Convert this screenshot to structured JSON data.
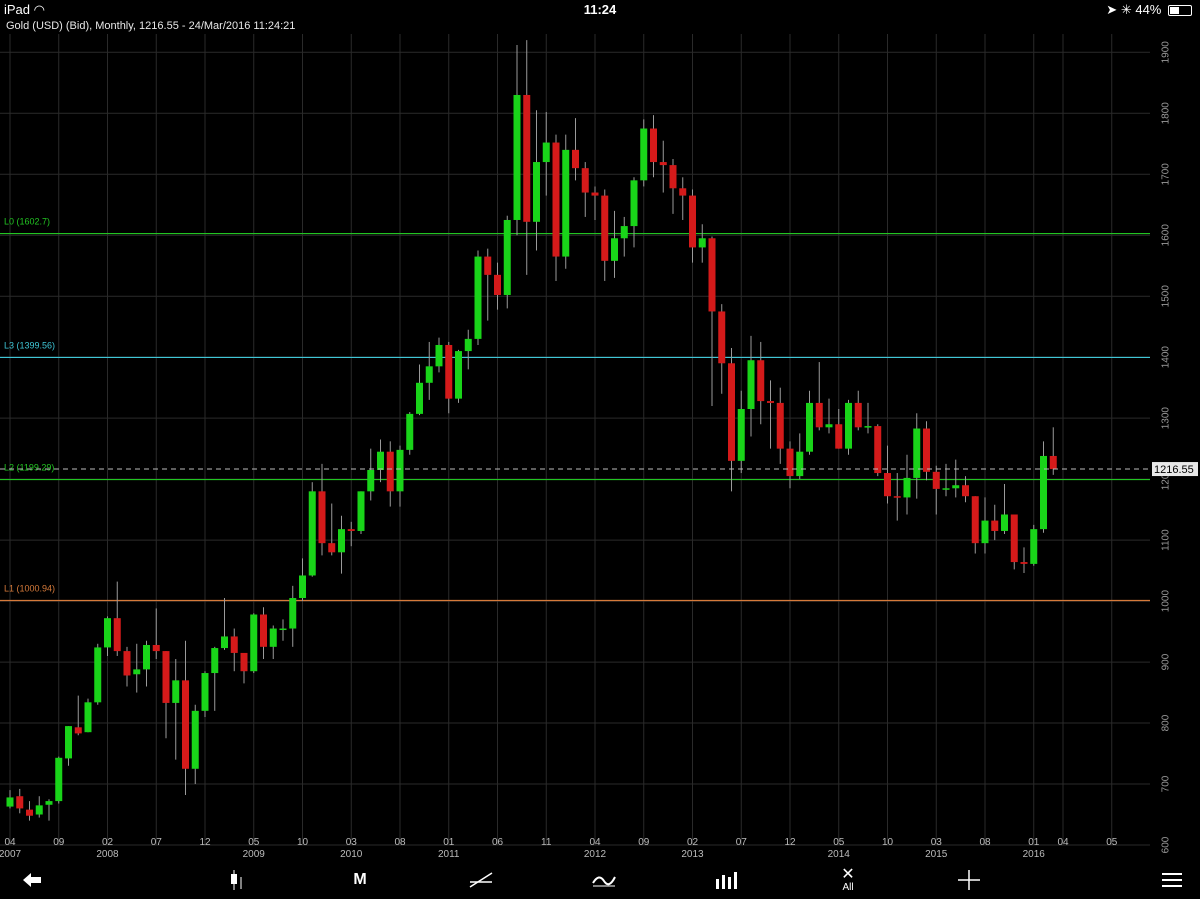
{
  "status_bar": {
    "device": "iPad",
    "time": "11:24",
    "battery": "44%"
  },
  "toolbar": {
    "period_label": "M",
    "delete_all_label": "All"
  },
  "colors": {
    "up": "#19d419",
    "down": "#d41a1a",
    "grid": "#2a2a2a",
    "fib_green": "#22c422",
    "fib_cyan": "#3fc6d6",
    "fib_orange": "#d67a3a",
    "price_line": "#bbbbbb"
  },
  "chart_data": {
    "type": "candlestick",
    "title": "Gold (USD) (Bid), Monthly, 1216.55 - 24/Mar/2016 11:24:21",
    "current_price": 1216.55,
    "ylim": [
      600,
      1930
    ],
    "y_ticks": [
      600,
      700,
      800,
      900,
      1000,
      1100,
      1200,
      1300,
      1400,
      1500,
      1600,
      1700,
      1800,
      1900
    ],
    "x_ticks": [
      {
        "month": "04",
        "year": "2007",
        "date": "2007-04"
      },
      {
        "month": "09",
        "year": "",
        "date": "2007-09"
      },
      {
        "month": "02",
        "year": "2008",
        "date": "2008-02"
      },
      {
        "month": "07",
        "year": "",
        "date": "2008-07"
      },
      {
        "month": "12",
        "year": "",
        "date": "2008-12"
      },
      {
        "month": "05",
        "year": "2009",
        "date": "2009-05"
      },
      {
        "month": "10",
        "year": "",
        "date": "2009-10"
      },
      {
        "month": "03",
        "year": "2010",
        "date": "2010-03"
      },
      {
        "month": "08",
        "year": "",
        "date": "2010-08"
      },
      {
        "month": "01",
        "year": "2011",
        "date": "2011-01"
      },
      {
        "month": "06",
        "year": "",
        "date": "2011-06"
      },
      {
        "month": "11",
        "year": "",
        "date": "2011-11"
      },
      {
        "month": "04",
        "year": "2012",
        "date": "2012-04"
      },
      {
        "month": "09",
        "year": "",
        "date": "2012-09"
      },
      {
        "month": "02",
        "year": "2013",
        "date": "2013-02"
      },
      {
        "month": "07",
        "year": "",
        "date": "2013-07"
      },
      {
        "month": "12",
        "year": "",
        "date": "2013-12"
      },
      {
        "month": "05",
        "year": "2014",
        "date": "2014-05"
      },
      {
        "month": "10",
        "year": "",
        "date": "2014-10"
      },
      {
        "month": "03",
        "year": "2015",
        "date": "2015-03"
      },
      {
        "month": "08",
        "year": "",
        "date": "2015-08"
      },
      {
        "month": "01",
        "year": "2016",
        "date": "2016-01"
      },
      {
        "month": "04",
        "year": "",
        "date": "2016-04"
      },
      {
        "month": "05",
        "year": "",
        "date": "2016-09"
      }
    ],
    "levels": [
      {
        "label": "L0 (1602.7)",
        "value": 1602.7,
        "color": "#22c422"
      },
      {
        "label": "L3 (1399.56)",
        "value": 1399.56,
        "color": "#3fc6d6"
      },
      {
        "label": "L2 (1199.29)",
        "value": 1199.29,
        "color": "#22c422"
      },
      {
        "label": "L1 (1000.94)",
        "value": 1000.94,
        "color": "#d67a3a"
      }
    ],
    "candles": [
      {
        "date": "2007-04",
        "open": 663,
        "high": 690,
        "low": 660,
        "close": 678
      },
      {
        "date": "2007-05",
        "open": 680,
        "high": 692,
        "low": 652,
        "close": 660
      },
      {
        "date": "2007-06",
        "open": 658,
        "high": 672,
        "low": 640,
        "close": 648
      },
      {
        "date": "2007-07",
        "open": 650,
        "high": 680,
        "low": 645,
        "close": 665
      },
      {
        "date": "2007-08",
        "open": 666,
        "high": 675,
        "low": 640,
        "close": 672
      },
      {
        "date": "2007-09",
        "open": 672,
        "high": 745,
        "low": 668,
        "close": 743
      },
      {
        "date": "2007-10",
        "open": 742,
        "high": 795,
        "low": 730,
        "close": 795
      },
      {
        "date": "2007-11",
        "open": 793,
        "high": 845,
        "low": 780,
        "close": 783
      },
      {
        "date": "2007-12",
        "open": 785,
        "high": 840,
        "low": 785,
        "close": 834
      },
      {
        "date": "2008-01",
        "open": 834,
        "high": 930,
        "low": 830,
        "close": 924
      },
      {
        "date": "2008-02",
        "open": 924,
        "high": 975,
        "low": 910,
        "close": 972
      },
      {
        "date": "2008-03",
        "open": 972,
        "high": 1032,
        "low": 910,
        "close": 918
      },
      {
        "date": "2008-04",
        "open": 918,
        "high": 925,
        "low": 860,
        "close": 878
      },
      {
        "date": "2008-05",
        "open": 880,
        "high": 930,
        "low": 850,
        "close": 888
      },
      {
        "date": "2008-06",
        "open": 888,
        "high": 935,
        "low": 860,
        "close": 928
      },
      {
        "date": "2008-07",
        "open": 928,
        "high": 988,
        "low": 905,
        "close": 918
      },
      {
        "date": "2008-08",
        "open": 918,
        "high": 918,
        "low": 775,
        "close": 833
      },
      {
        "date": "2008-09",
        "open": 833,
        "high": 905,
        "low": 740,
        "close": 870
      },
      {
        "date": "2008-10",
        "open": 870,
        "high": 935,
        "low": 682,
        "close": 725
      },
      {
        "date": "2008-11",
        "open": 725,
        "high": 830,
        "low": 700,
        "close": 820
      },
      {
        "date": "2008-12",
        "open": 820,
        "high": 885,
        "low": 810,
        "close": 882
      },
      {
        "date": "2009-01",
        "open": 882,
        "high": 925,
        "low": 820,
        "close": 923
      },
      {
        "date": "2009-02",
        "open": 923,
        "high": 1005,
        "low": 920,
        "close": 942
      },
      {
        "date": "2009-03",
        "open": 942,
        "high": 955,
        "low": 885,
        "close": 915
      },
      {
        "date": "2009-04",
        "open": 915,
        "high": 912,
        "low": 865,
        "close": 885
      },
      {
        "date": "2009-05",
        "open": 885,
        "high": 980,
        "low": 882,
        "close": 978
      },
      {
        "date": "2009-06",
        "open": 978,
        "high": 990,
        "low": 905,
        "close": 925
      },
      {
        "date": "2009-07",
        "open": 925,
        "high": 960,
        "low": 905,
        "close": 955
      },
      {
        "date": "2009-08",
        "open": 955,
        "high": 970,
        "low": 935,
        "close": 955
      },
      {
        "date": "2009-09",
        "open": 955,
        "high": 1025,
        "low": 925,
        "close": 1005
      },
      {
        "date": "2009-10",
        "open": 1005,
        "high": 1070,
        "low": 1000,
        "close": 1042
      },
      {
        "date": "2009-11",
        "open": 1042,
        "high": 1195,
        "low": 1040,
        "close": 1180
      },
      {
        "date": "2009-12",
        "open": 1180,
        "high": 1225,
        "low": 1075,
        "close": 1095
      },
      {
        "date": "2010-01",
        "open": 1095,
        "high": 1160,
        "low": 1075,
        "close": 1080
      },
      {
        "date": "2010-02",
        "open": 1080,
        "high": 1140,
        "low": 1045,
        "close": 1118
      },
      {
        "date": "2010-03",
        "open": 1118,
        "high": 1130,
        "low": 1090,
        "close": 1115
      },
      {
        "date": "2010-04",
        "open": 1115,
        "high": 1180,
        "low": 1110,
        "close": 1180
      },
      {
        "date": "2010-05",
        "open": 1180,
        "high": 1250,
        "low": 1165,
        "close": 1215
      },
      {
        "date": "2010-06",
        "open": 1215,
        "high": 1265,
        "low": 1195,
        "close": 1245
      },
      {
        "date": "2010-07",
        "open": 1245,
        "high": 1262,
        "low": 1155,
        "close": 1180
      },
      {
        "date": "2010-08",
        "open": 1180,
        "high": 1255,
        "low": 1155,
        "close": 1248
      },
      {
        "date": "2010-09",
        "open": 1248,
        "high": 1310,
        "low": 1240,
        "close": 1307
      },
      {
        "date": "2010-10",
        "open": 1307,
        "high": 1388,
        "low": 1305,
        "close": 1358
      },
      {
        "date": "2010-11",
        "open": 1358,
        "high": 1425,
        "low": 1330,
        "close": 1385
      },
      {
        "date": "2010-12",
        "open": 1385,
        "high": 1432,
        "low": 1375,
        "close": 1420
      },
      {
        "date": "2011-01",
        "open": 1420,
        "high": 1425,
        "low": 1308,
        "close": 1332
      },
      {
        "date": "2011-02",
        "open": 1332,
        "high": 1412,
        "low": 1325,
        "close": 1410
      },
      {
        "date": "2011-03",
        "open": 1410,
        "high": 1445,
        "low": 1380,
        "close": 1430
      },
      {
        "date": "2011-04",
        "open": 1430,
        "high": 1575,
        "low": 1420,
        "close": 1565
      },
      {
        "date": "2011-05",
        "open": 1565,
        "high": 1578,
        "low": 1460,
        "close": 1535
      },
      {
        "date": "2011-06",
        "open": 1535,
        "high": 1555,
        "low": 1478,
        "close": 1502
      },
      {
        "date": "2011-07",
        "open": 1502,
        "high": 1632,
        "low": 1480,
        "close": 1625
      },
      {
        "date": "2011-08",
        "open": 1625,
        "high": 1912,
        "low": 1600,
        "close": 1830
      },
      {
        "date": "2011-09",
        "open": 1830,
        "high": 1920,
        "low": 1535,
        "close": 1622
      },
      {
        "date": "2011-10",
        "open": 1622,
        "high": 1805,
        "low": 1575,
        "close": 1720
      },
      {
        "date": "2011-11",
        "open": 1720,
        "high": 1802,
        "low": 1665,
        "close": 1752
      },
      {
        "date": "2011-12",
        "open": 1752,
        "high": 1765,
        "low": 1525,
        "close": 1565
      },
      {
        "date": "2012-01",
        "open": 1565,
        "high": 1765,
        "low": 1545,
        "close": 1740
      },
      {
        "date": "2012-02",
        "open": 1740,
        "high": 1792,
        "low": 1690,
        "close": 1710
      },
      {
        "date": "2012-03",
        "open": 1710,
        "high": 1720,
        "low": 1630,
        "close": 1670
      },
      {
        "date": "2012-04",
        "open": 1670,
        "high": 1680,
        "low": 1625,
        "close": 1665
      },
      {
        "date": "2012-05",
        "open": 1665,
        "high": 1675,
        "low": 1525,
        "close": 1558
      },
      {
        "date": "2012-06",
        "open": 1558,
        "high": 1640,
        "low": 1530,
        "close": 1595
      },
      {
        "date": "2012-07",
        "open": 1595,
        "high": 1630,
        "low": 1565,
        "close": 1615
      },
      {
        "date": "2012-08",
        "open": 1615,
        "high": 1695,
        "low": 1580,
        "close": 1690
      },
      {
        "date": "2012-09",
        "open": 1690,
        "high": 1790,
        "low": 1680,
        "close": 1775
      },
      {
        "date": "2012-10",
        "open": 1775,
        "high": 1797,
        "low": 1695,
        "close": 1720
      },
      {
        "date": "2012-11",
        "open": 1720,
        "high": 1755,
        "low": 1670,
        "close": 1715
      },
      {
        "date": "2012-12",
        "open": 1715,
        "high": 1725,
        "low": 1635,
        "close": 1677
      },
      {
        "date": "2013-01",
        "open": 1677,
        "high": 1695,
        "low": 1625,
        "close": 1665
      },
      {
        "date": "2013-02",
        "open": 1665,
        "high": 1675,
        "low": 1555,
        "close": 1580
      },
      {
        "date": "2013-03",
        "open": 1580,
        "high": 1618,
        "low": 1555,
        "close": 1595
      },
      {
        "date": "2013-04",
        "open": 1595,
        "high": 1598,
        "low": 1320,
        "close": 1475
      },
      {
        "date": "2013-05",
        "open": 1475,
        "high": 1487,
        "low": 1340,
        "close": 1390
      },
      {
        "date": "2013-06",
        "open": 1390,
        "high": 1415,
        "low": 1180,
        "close": 1230
      },
      {
        "date": "2013-07",
        "open": 1230,
        "high": 1345,
        "low": 1210,
        "close": 1315
      },
      {
        "date": "2013-08",
        "open": 1315,
        "high": 1435,
        "low": 1270,
        "close": 1395
      },
      {
        "date": "2013-09",
        "open": 1395,
        "high": 1425,
        "low": 1290,
        "close": 1328
      },
      {
        "date": "2013-10",
        "open": 1328,
        "high": 1362,
        "low": 1250,
        "close": 1325
      },
      {
        "date": "2013-11",
        "open": 1325,
        "high": 1350,
        "low": 1225,
        "close": 1250
      },
      {
        "date": "2013-12",
        "open": 1250,
        "high": 1262,
        "low": 1185,
        "close": 1205
      },
      {
        "date": "2014-01",
        "open": 1205,
        "high": 1275,
        "low": 1200,
        "close": 1245
      },
      {
        "date": "2014-02",
        "open": 1245,
        "high": 1345,
        "low": 1240,
        "close": 1325
      },
      {
        "date": "2014-03",
        "open": 1325,
        "high": 1392,
        "low": 1280,
        "close": 1285
      },
      {
        "date": "2014-04",
        "open": 1285,
        "high": 1332,
        "low": 1275,
        "close": 1290
      },
      {
        "date": "2014-05",
        "open": 1290,
        "high": 1315,
        "low": 1250,
        "close": 1250
      },
      {
        "date": "2014-06",
        "open": 1250,
        "high": 1330,
        "low": 1240,
        "close": 1325
      },
      {
        "date": "2014-07",
        "open": 1325,
        "high": 1345,
        "low": 1280,
        "close": 1285
      },
      {
        "date": "2014-08",
        "open": 1285,
        "high": 1325,
        "low": 1275,
        "close": 1287
      },
      {
        "date": "2014-09",
        "open": 1287,
        "high": 1290,
        "low": 1205,
        "close": 1210
      },
      {
        "date": "2014-10",
        "open": 1210,
        "high": 1255,
        "low": 1160,
        "close": 1172
      },
      {
        "date": "2014-11",
        "open": 1172,
        "high": 1210,
        "low": 1132,
        "close": 1170
      },
      {
        "date": "2014-12",
        "open": 1170,
        "high": 1240,
        "low": 1142,
        "close": 1202
      },
      {
        "date": "2015-01",
        "open": 1202,
        "high": 1308,
        "low": 1168,
        "close": 1283
      },
      {
        "date": "2015-02",
        "open": 1283,
        "high": 1295,
        "low": 1198,
        "close": 1212
      },
      {
        "date": "2015-03",
        "open": 1212,
        "high": 1222,
        "low": 1142,
        "close": 1184
      },
      {
        "date": "2015-04",
        "open": 1184,
        "high": 1225,
        "low": 1172,
        "close": 1185
      },
      {
        "date": "2015-05",
        "open": 1185,
        "high": 1232,
        "low": 1170,
        "close": 1190
      },
      {
        "date": "2015-06",
        "open": 1190,
        "high": 1205,
        "low": 1162,
        "close": 1172
      },
      {
        "date": "2015-07",
        "open": 1172,
        "high": 1172,
        "low": 1078,
        "close": 1095
      },
      {
        "date": "2015-08",
        "open": 1095,
        "high": 1170,
        "low": 1078,
        "close": 1132
      },
      {
        "date": "2015-09",
        "open": 1132,
        "high": 1158,
        "low": 1100,
        "close": 1115
      },
      {
        "date": "2015-10",
        "open": 1115,
        "high": 1192,
        "low": 1110,
        "close": 1142
      },
      {
        "date": "2015-11",
        "open": 1142,
        "high": 1142,
        "low": 1052,
        "close": 1064
      },
      {
        "date": "2015-12",
        "open": 1064,
        "high": 1088,
        "low": 1046,
        "close": 1061
      },
      {
        "date": "2016-01",
        "open": 1061,
        "high": 1125,
        "low": 1058,
        "close": 1118
      },
      {
        "date": "2016-02",
        "open": 1118,
        "high": 1262,
        "low": 1112,
        "close": 1238
      },
      {
        "date": "2016-03",
        "open": 1238,
        "high": 1285,
        "low": 1207,
        "close": 1216.55
      }
    ]
  }
}
